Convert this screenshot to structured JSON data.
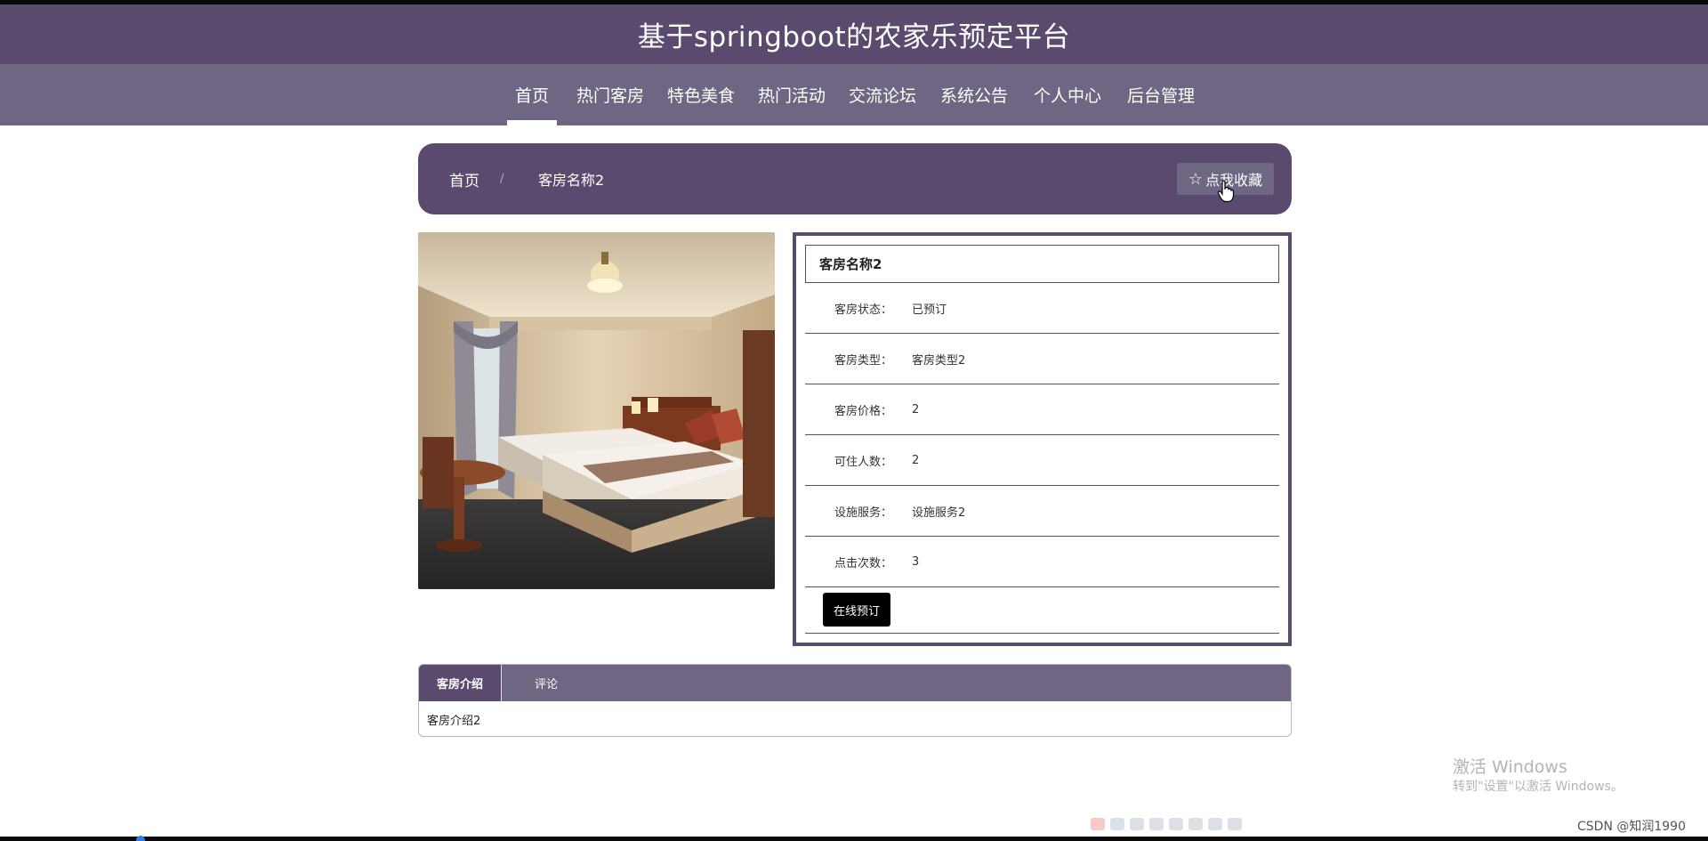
{
  "site": {
    "title": "基于springboot的农家乐预定平台"
  },
  "nav": {
    "items": [
      {
        "label": "首页",
        "active": true
      },
      {
        "label": "热门客房"
      },
      {
        "label": "特色美食"
      },
      {
        "label": "热门活动"
      },
      {
        "label": "交流论坛"
      },
      {
        "label": "系统公告"
      },
      {
        "label": "个人中心"
      },
      {
        "label": "后台管理"
      }
    ]
  },
  "breadcrumb": {
    "home": "首页",
    "separator": "/",
    "current": "客房名称2"
  },
  "favorite": {
    "label": "点我收藏",
    "icon": "star-outline-icon"
  },
  "room": {
    "image_alt": "客房照片",
    "title": "客房名称2",
    "fields": [
      {
        "label": "客房状态：",
        "value": "已预订"
      },
      {
        "label": "客房类型：",
        "value": "客房类型2"
      },
      {
        "label": "客房价格：",
        "value": "2"
      },
      {
        "label": "可住人数：",
        "value": "2"
      },
      {
        "label": "设施服务：",
        "value": "设施服务2"
      },
      {
        "label": "点击次数：",
        "value": "3"
      }
    ],
    "book_label": "在线预订"
  },
  "tabs": {
    "items": [
      {
        "label": "客房介绍",
        "active": true
      },
      {
        "label": "评论"
      }
    ],
    "content": "客房介绍2"
  },
  "watermark": {
    "line1": "激活 Windows",
    "line2": "转到\"设置\"以激活 Windows。"
  },
  "credit": "CSDN @知润1990",
  "colors": {
    "primary": "#5a4a6e",
    "secondary": "#6e6683"
  }
}
